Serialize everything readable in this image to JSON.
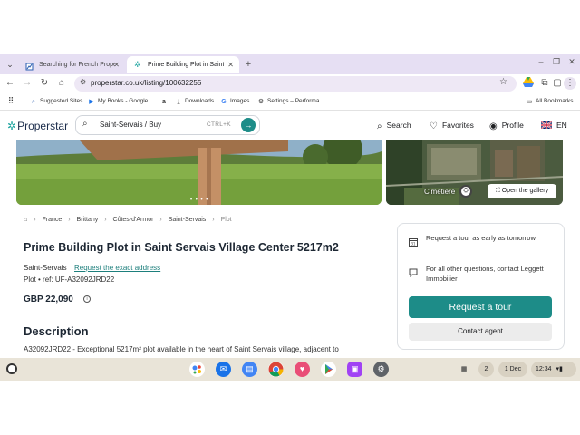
{
  "browser": {
    "tabs": [
      {
        "title": "Searching for French Property",
        "active": false
      },
      {
        "title": "Prime Building Plot in Saint Se",
        "active": true
      }
    ],
    "new_tab": "+",
    "url": "properstar.co.uk/listing/100632255",
    "bookmarks": [
      "Suggested Sites",
      "My Books - Google...",
      "Downloads",
      "Images",
      "Settings – Performa..."
    ],
    "all_bookmarks": "All Bookmarks"
  },
  "header": {
    "logo": "Properstar",
    "search_value": "Saint-Servais / Buy",
    "shortcut": "CTRL+K",
    "nav": {
      "search": "Search",
      "favorites": "Favorites",
      "profile": "Profile",
      "language": "EN"
    }
  },
  "gallery": {
    "map_label": "Cimetière",
    "open_gallery": "Open the gallery"
  },
  "breadcrumb": [
    "France",
    "Brittany",
    "Côtes-d'Armor",
    "Saint-Servais",
    "Plot"
  ],
  "listing": {
    "title": "Prime Building Plot in Saint Servais Village Center 5217m2",
    "location": "Saint-Servais",
    "address_link": "Request the exact address",
    "ref": "Plot • ref: UF-A32092JRD22",
    "price": "GBP 22,090",
    "description_heading": "Description",
    "description_text": "A32092JRD22 - Exceptional 5217m² plot available in the heart of Saint Servais village, adjacent to"
  },
  "contact": {
    "tour_note": "Request a tour as early as tomorrow",
    "questions_note": "For all other questions, contact Leggett Immobilier",
    "tour_button": "Request a tour",
    "agent_button": "Contact agent"
  },
  "taskbar": {
    "notifications": "2",
    "date": "1 Dec",
    "time": "12:34"
  },
  "colors": {
    "accent": "#1d8c88",
    "link": "#1d7f7c",
    "tabstrip": "#e6dff3",
    "shelf": "#e9e4d8"
  }
}
